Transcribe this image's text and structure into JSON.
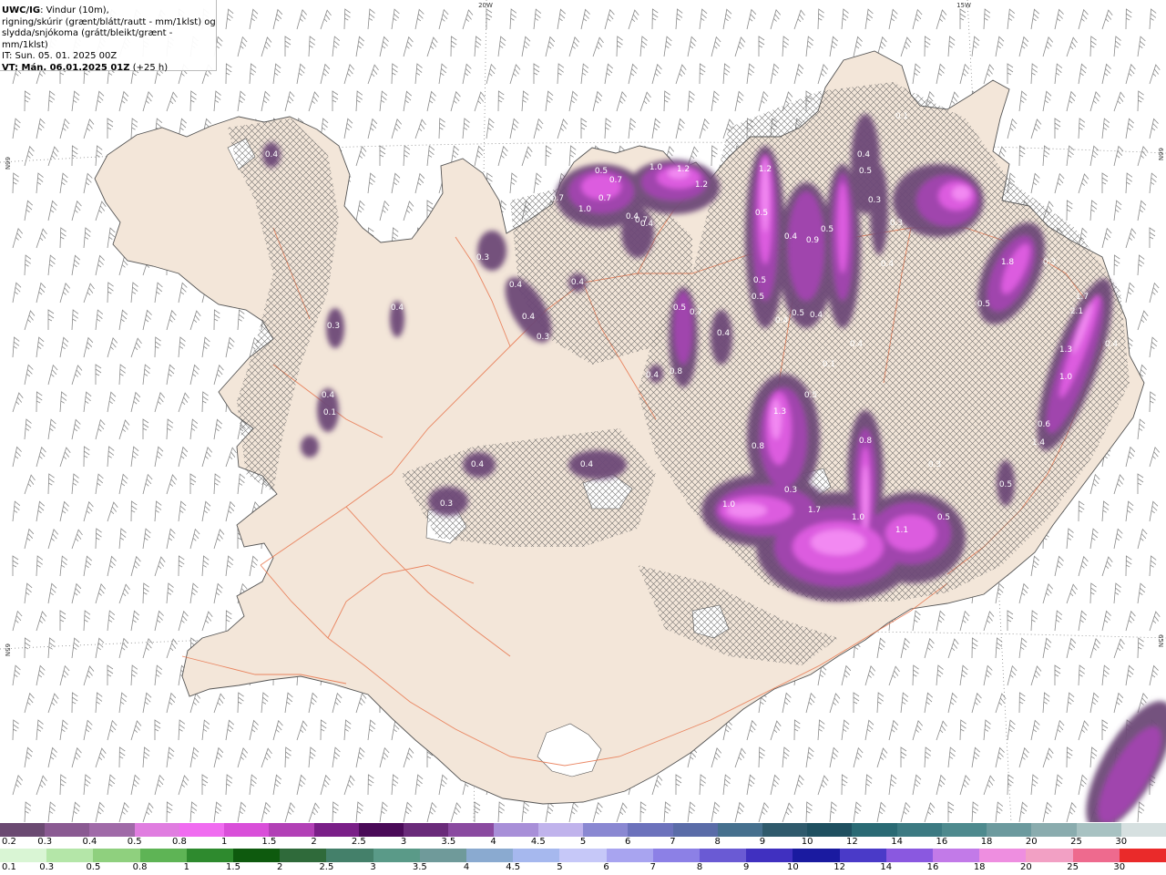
{
  "header": {
    "title_bold": "UWC/IG",
    "title_rest": ": Vindur (10m),",
    "line2": "rigning/skúrir (grænt/blátt/rautt - mm/1klst) og",
    "line3": "slydda/snjókoma (grátt/bleikt/grænt - mm/1klst)",
    "line4": "IT: Sun. 05. 01. 2025 00Z",
    "line5_bold": "VT: Mán. 06.01.2025 01Z",
    "line5_rest": " (+25 h)"
  },
  "graticule": {
    "lon_top": [
      "20W",
      "15W"
    ],
    "lat_left": [
      "66N",
      "65N"
    ],
    "lat_right": [
      "66N",
      "65N"
    ]
  },
  "colors": {
    "sea": "#ffffff",
    "land": "#f3e6d9",
    "coast": "#666666",
    "roads": "#e8734a",
    "barbs": "#8a8a8a",
    "snow_light": "#6e4a78",
    "snow_mid": "#9a3fa8",
    "snow_high": "#d24fd8",
    "snow_peak": "#f283f2"
  },
  "precip_labels": [
    "0.4",
    "0.5",
    "1.0",
    "1.2",
    "1.2",
    "0.7",
    "0.7",
    "0.7",
    "1.0",
    "0.4",
    "0.4",
    "0.4",
    "0.3",
    "0.4",
    "0.4",
    "0.3",
    "0.3",
    "0.4",
    "0.4",
    "0.1",
    "0.5",
    "0.7",
    "1.2",
    "0.5",
    "0.5",
    "0.4",
    "0.5",
    "0.4",
    "0.5",
    "0.4",
    "0.1",
    "0.8",
    "0.7",
    "0.9",
    "0.4",
    "0.5",
    "0.3",
    "0.3",
    "0.4",
    "1.8",
    "0.3",
    "0.5",
    "1.7",
    "2.1",
    "1.3",
    "1.0",
    "0.4",
    "0.6",
    "1.4",
    "0.5",
    "0.4",
    "0.4",
    "0.3",
    "0.3",
    "0.4",
    "0.4",
    "0.4",
    "0.5",
    "1.3",
    "0.8",
    "0.5",
    "0.8",
    "0.3",
    "1.0",
    "1.7",
    "1.0",
    "1.1",
    "0.5",
    "0.1"
  ],
  "legend": {
    "snow": {
      "labels": [
        "0.2",
        "0.3",
        "0.4",
        "0.5",
        "0.8",
        "1",
        "1.5",
        "2",
        "2.5",
        "3",
        "3.5",
        "4",
        "4.5",
        "5",
        "6",
        "7",
        "8",
        "9",
        "10",
        "12",
        "14",
        "16",
        "18",
        "20",
        "25",
        "30"
      ],
      "colors": [
        "#6b4a72",
        "#8a5a92",
        "#a06aa8",
        "#e07de0",
        "#f06cf0",
        "#d94fd9",
        "#b240b6",
        "#7a1f88",
        "#4a0a58",
        "#6a2b7a",
        "#8a4aa0",
        "#a88fd8",
        "#c0b3ec",
        "#8a88d2",
        "#6c72bc",
        "#5a6ca8",
        "#46708e",
        "#2f5a6c",
        "#1f5060",
        "#2a6a74",
        "#3c7a82",
        "#4e8a8e",
        "#6c9a9e",
        "#8aacae",
        "#a8c2c2",
        "#d6e0e0"
      ]
    },
    "rain": {
      "labels": [
        "0.1",
        "0.3",
        "0.5",
        "0.8",
        "1",
        "1.5",
        "2",
        "2.5",
        "3",
        "3.5",
        "4",
        "4.5",
        "5",
        "6",
        "7",
        "8",
        "9",
        "10",
        "12",
        "14",
        "16",
        "18",
        "20",
        "25",
        "30"
      ],
      "colors": [
        "#d9f5d4",
        "#b4e6a8",
        "#8fd07e",
        "#5eb455",
        "#2e8a2e",
        "#0e5a0e",
        "#2f6a3a",
        "#44806a",
        "#5a9a88",
        "#6f9a9a",
        "#8aaad0",
        "#a6b8ee",
        "#c6c8f8",
        "#a8a4f0",
        "#8c80e6",
        "#6a5ad4",
        "#4030c0",
        "#1a1aa0",
        "#4a3ac8",
        "#8a58e0",
        "#c27ae8",
        "#ee8ee0",
        "#f2a0c4",
        "#ee6a8e",
        "#ea2a2a"
      ]
    }
  }
}
